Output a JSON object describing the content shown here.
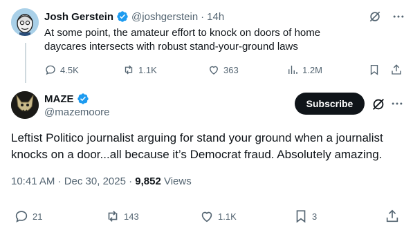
{
  "parent": {
    "name": "Josh Gerstein",
    "handle": "@joshgerstein",
    "separator": "·",
    "time": "14h",
    "text": "At some point, the amateur effort to knock on doors of home daycares intersects with robust stand-your-ground laws",
    "replies": "4.5K",
    "reposts": "1.1K",
    "likes": "363",
    "views": "1.2M"
  },
  "main": {
    "name": "MAZE",
    "handle": "@mazemoore",
    "subscribe_label": "Subscribe",
    "text": "Leftist Politico journalist arguing for stand your ground when a journalist knocks on a door...all because it’s Democrat fraud. Absolutely amazing.",
    "timestamp": "10:41 AM · Dec 30, 2025 · ",
    "views_count": "9,852",
    "views_label": " Views",
    "replies": "21",
    "reposts": "143",
    "likes": "1.1K",
    "bookmarks": "3"
  },
  "colors": {
    "text_primary": "#0f1419",
    "text_secondary": "#536471",
    "verified": "#1d9bf0",
    "thread_line": "#cfd9de"
  }
}
